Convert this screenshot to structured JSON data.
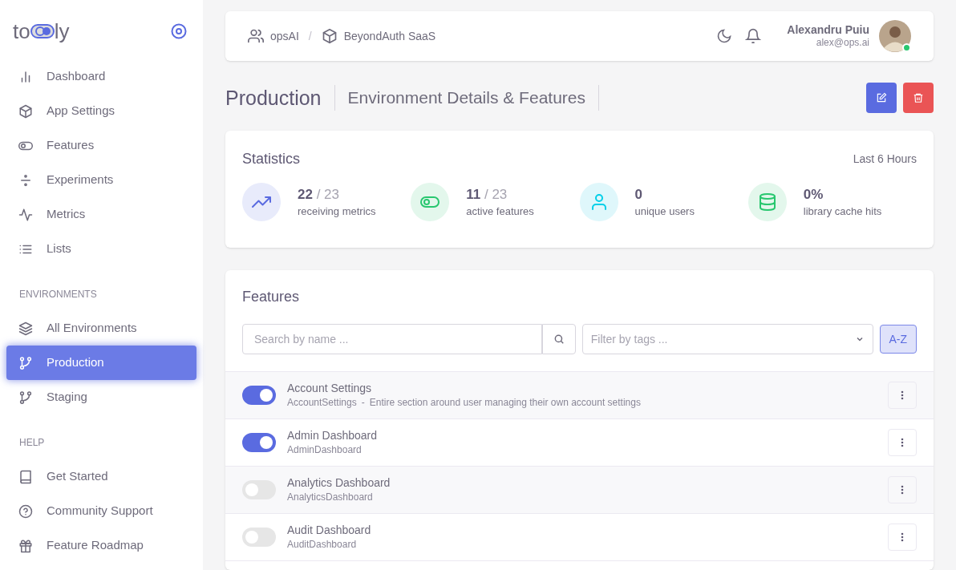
{
  "logo": {
    "left": "to",
    "right": "ly"
  },
  "sidebar": {
    "groups": [
      {
        "items": [
          {
            "label": "Dashboard",
            "kind": "bars",
            "selected": false
          },
          {
            "label": "App Settings",
            "kind": "cube",
            "selected": false
          },
          {
            "label": "Features",
            "kind": "toggle",
            "selected": false
          },
          {
            "label": "Experiments",
            "kind": "divide",
            "selected": false
          },
          {
            "label": "Metrics",
            "kind": "pulse",
            "selected": false
          },
          {
            "label": "Lists",
            "kind": "list",
            "selected": false
          }
        ]
      },
      {
        "heading": "ENVIRONMENTS",
        "items": [
          {
            "label": "All Environments",
            "kind": "layers",
            "selected": false
          },
          {
            "label": "Production",
            "kind": "branch",
            "selected": true
          },
          {
            "label": "Staging",
            "kind": "branch",
            "selected": false
          }
        ]
      },
      {
        "heading": "HELP",
        "items": [
          {
            "label": "Get Started",
            "kind": "book",
            "selected": false
          },
          {
            "label": "Community Support",
            "kind": "help",
            "selected": false
          },
          {
            "label": "Feature Roadmap",
            "kind": "gift",
            "selected": false
          }
        ]
      }
    ]
  },
  "breadcrumbs": [
    {
      "label": "opsAI",
      "kind": "users"
    },
    {
      "label": "BeyondAuth SaaS",
      "kind": "cube"
    }
  ],
  "breadcrumb_separator": "/",
  "user": {
    "name": "Alexandru Puiu",
    "email": "alex@ops.ai",
    "online": true
  },
  "page": {
    "title": "Production",
    "subtitle": "Environment Details & Features"
  },
  "statistics": {
    "title": "Statistics",
    "range": "Last 6 Hours",
    "items": [
      {
        "value": "22",
        "total": "/ 23",
        "label": "receiving metrics",
        "kind": "trend",
        "color": "#e8ebfb"
      },
      {
        "value": "11",
        "total": "/ 23",
        "label": "active features",
        "kind": "toggle",
        "color": "#e3f7ec"
      },
      {
        "value": "0",
        "label": "unique users",
        "kind": "user",
        "color": "#dff7fb"
      },
      {
        "value": "0%",
        "label": "library cache hits",
        "kind": "database",
        "color": "#e3f7ec"
      }
    ]
  },
  "features": {
    "title": "Features",
    "search_placeholder": "Search by name ...",
    "filter_placeholder": "Filter by tags ...",
    "sort_button": "A-Z",
    "rows": [
      {
        "name": "Account Settings",
        "key": "AccountSettings",
        "separator": "-",
        "description": "Entire section around user managing their own account settings",
        "on": true
      },
      {
        "name": "Admin Dashboard",
        "key": "AdminDashboard",
        "on": true
      },
      {
        "name": "Analytics Dashboard",
        "key": "AnalyticsDashboard",
        "on": false
      },
      {
        "name": "Audit Dashboard",
        "key": "AuditDashboard",
        "on": false
      }
    ]
  }
}
